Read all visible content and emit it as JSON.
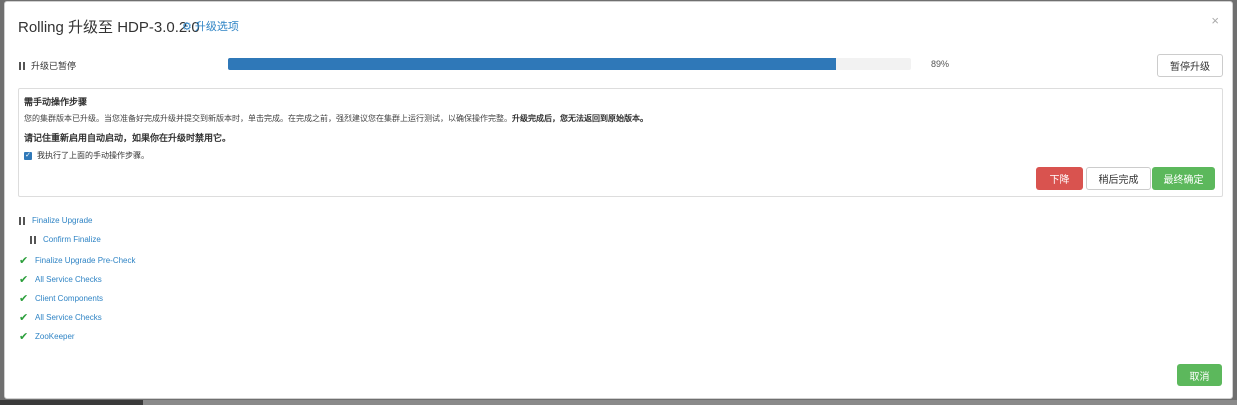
{
  "header": {
    "title": "Rolling 升级至 HDP-3.0.2.0",
    "upgrade_options_label": "升级选项",
    "upgrade_options_icon": "gears-icon",
    "close_label": "×"
  },
  "status": {
    "label": "升级已暂停",
    "progress_percent": 89,
    "progress_text": "89%",
    "pause_button": "暂停升级"
  },
  "manual_step": {
    "title": "需手动操作步骤",
    "body_text": "您的集群版本已升级。当您准备好完成升级并提交到新版本时，单击完成。在完成之前，强烈建议您在集群上运行测试，以确保操作完整。",
    "body_bold": "升级完成后，您无法返回到原始版本。",
    "warning": "请记住重新启用自动启动，如果你在升级时禁用它。",
    "checkbox_label": "我执行了上面的手动操作步骤。",
    "checkbox_checked": true,
    "downgrade_button": "下降",
    "later_button": "稍后完成",
    "finalize_button": "最终确定"
  },
  "tasks": [
    {
      "label": "Finalize Upgrade",
      "state": "paused"
    },
    {
      "label": "Confirm Finalize",
      "state": "paused"
    },
    {
      "label": "Finalize Upgrade Pre-Check",
      "state": "done"
    },
    {
      "label": "All Service Checks",
      "state": "done"
    },
    {
      "label": "Client Components",
      "state": "done"
    },
    {
      "label": "All Service Checks",
      "state": "done"
    },
    {
      "label": "ZooKeeper",
      "state": "done"
    }
  ],
  "footer": {
    "cancel_button": "取消"
  },
  "colors": {
    "progress": "#2f78b8",
    "danger": "#d9534f",
    "success": "#5cb85c",
    "link": "#2f84c5",
    "check": "#2a9e3a"
  }
}
